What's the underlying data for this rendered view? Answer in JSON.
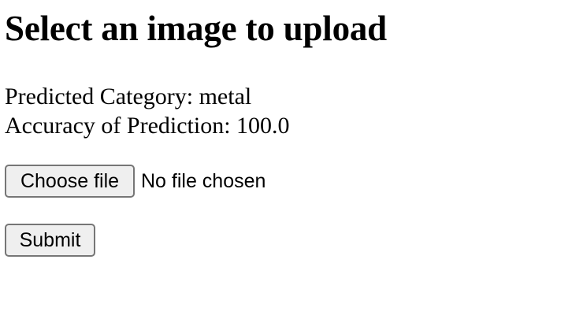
{
  "page": {
    "heading": "Select an image to upload"
  },
  "results": {
    "predicted_category": "Predicted Category: metal",
    "accuracy": "Accuracy of Prediction: 100.0"
  },
  "file_input": {
    "button_label": "Choose file",
    "status": "No file chosen"
  },
  "form": {
    "submit_label": "Submit"
  },
  "colors": {
    "button_bg": "#efefef",
    "button_border": "#767676",
    "text": "#000000",
    "background": "#ffffff"
  }
}
